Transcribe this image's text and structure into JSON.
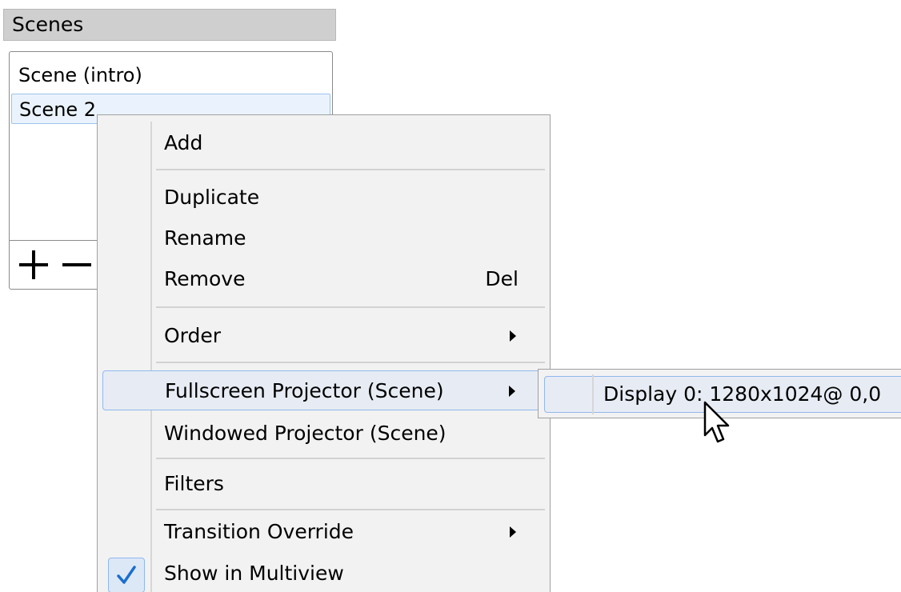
{
  "dock": {
    "title": "Scenes",
    "scenes": [
      {
        "label": "Scene (intro)",
        "selected": false
      },
      {
        "label": "Scene 2",
        "selected": true
      }
    ],
    "toolbar": {
      "add_icon": "plus-icon",
      "remove_icon": "minus-icon"
    }
  },
  "context_menu": {
    "items": [
      {
        "label": "Add"
      },
      {
        "label": "Duplicate"
      },
      {
        "label": "Rename"
      },
      {
        "label": "Remove",
        "shortcut": "Del"
      },
      {
        "label": "Order",
        "has_submenu": true
      },
      {
        "label": "Fullscreen Projector (Scene)",
        "has_submenu": true,
        "highlighted": true
      },
      {
        "label": "Windowed Projector (Scene)"
      },
      {
        "label": "Filters"
      },
      {
        "label": "Transition Override",
        "has_submenu": true
      },
      {
        "label": "Show in Multiview",
        "checked": true
      }
    ]
  },
  "submenu": {
    "items": [
      {
        "label": "Display 0: 1280x1024@ 0,0",
        "highlighted": true
      }
    ]
  },
  "colors": {
    "highlight_fill": "#e7ecf4",
    "highlight_border": "#8fb8ee",
    "menu_bg": "#f2f2f2",
    "check_color": "#1a6fcf"
  }
}
